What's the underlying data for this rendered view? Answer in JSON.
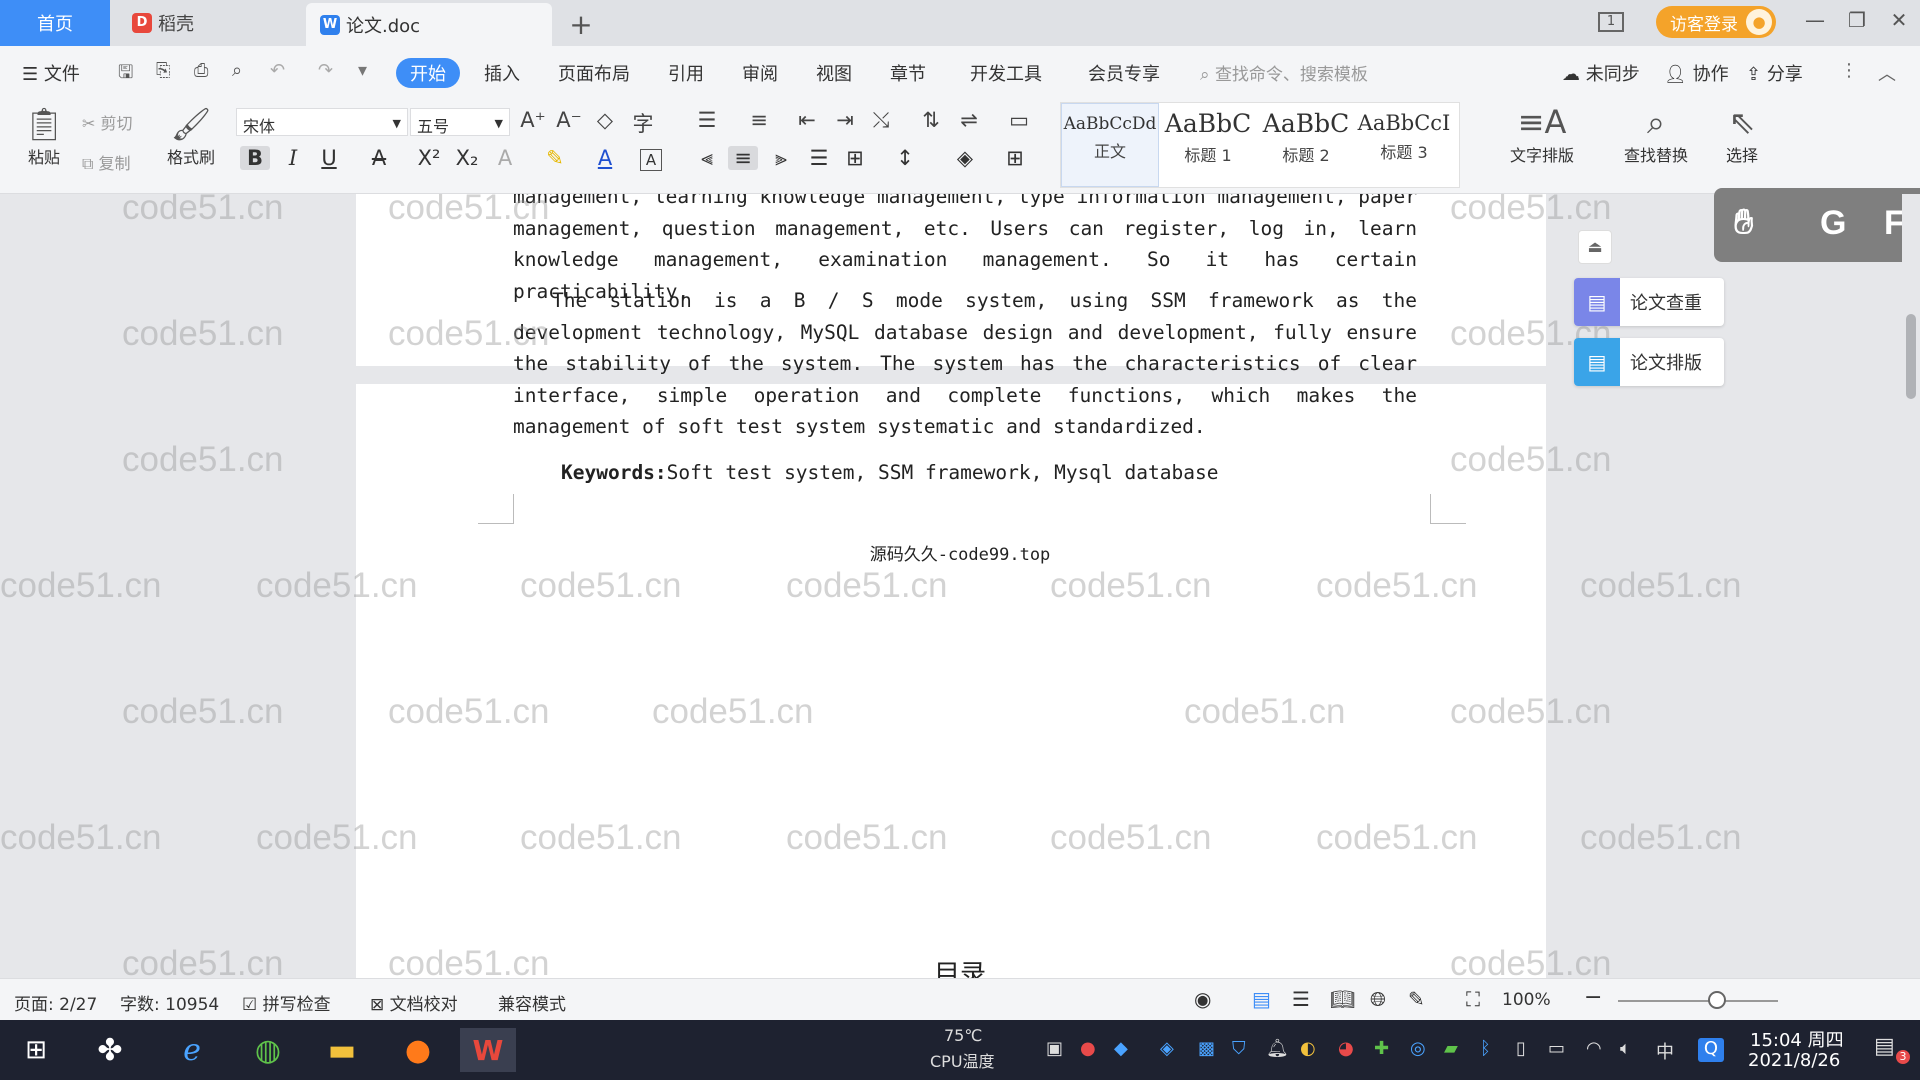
{
  "tabs": {
    "home": "首页",
    "docer": "稻壳",
    "doc": "论文.doc",
    "new_tab": "+"
  },
  "window": {
    "login": "访客登录",
    "layout_icon": "1",
    "minimize": "—",
    "restore": "❐",
    "close": "✕"
  },
  "menu": {
    "file": "文件",
    "items": [
      "开始",
      "插入",
      "页面布局",
      "引用",
      "审阅",
      "视图",
      "章节",
      "开发工具",
      "会员专享"
    ],
    "search_placeholder": "查找命令、搜索模板",
    "sync": "未同步",
    "collab": "协作",
    "share": "分享"
  },
  "ribbon": {
    "paste": "粘贴",
    "cut": "剪切",
    "copy": "复制",
    "format_painter": "格式刷",
    "font_name": "宋体",
    "font_size": "五号",
    "styles": [
      {
        "sample": "AaBbCcDd",
        "name": "正文"
      },
      {
        "sample": "AaBbC",
        "name": "标题 1"
      },
      {
        "sample": "AaBbC",
        "name": "标题 2"
      },
      {
        "sample": "AaBbCcI",
        "name": "标题 3"
      }
    ],
    "text_layout": "文字排版",
    "find_replace": "查找替换",
    "select": "选择"
  },
  "document": {
    "para1": "management, learning knowledge management, type information management, paper management, question management, etc. Users can register, log in, learn knowledge management, examination management. So it has certain practicability.",
    "para2": "The station is a B / S mode system, using SSM framework as the development technology, MySQL database design and development, fully ensure the stability of the system. The system has the characteristics of clear interface, simple operation and complete functions, which makes the management of soft test system systematic and standardized.",
    "keywords_label": "Keywords:",
    "keywords": "Soft test system, SSM framework, Mysql database",
    "footer": "源码久久-code99.top",
    "next_heading": "目录",
    "watermark": "code51.cn"
  },
  "side_panel": {
    "check": "论文查重",
    "format": "论文排版"
  },
  "status": {
    "page": "页面: 2/27",
    "words": "字数: 10954",
    "spell": "拼写检查",
    "proof": "文档校对",
    "compat": "兼容模式",
    "zoom": "100%"
  },
  "taskbar": {
    "temp": "75℃",
    "cpu": "CPU温度",
    "time": "15:04 周四",
    "date": "2021/8/26",
    "ime": "中",
    "notif_count": "3"
  }
}
